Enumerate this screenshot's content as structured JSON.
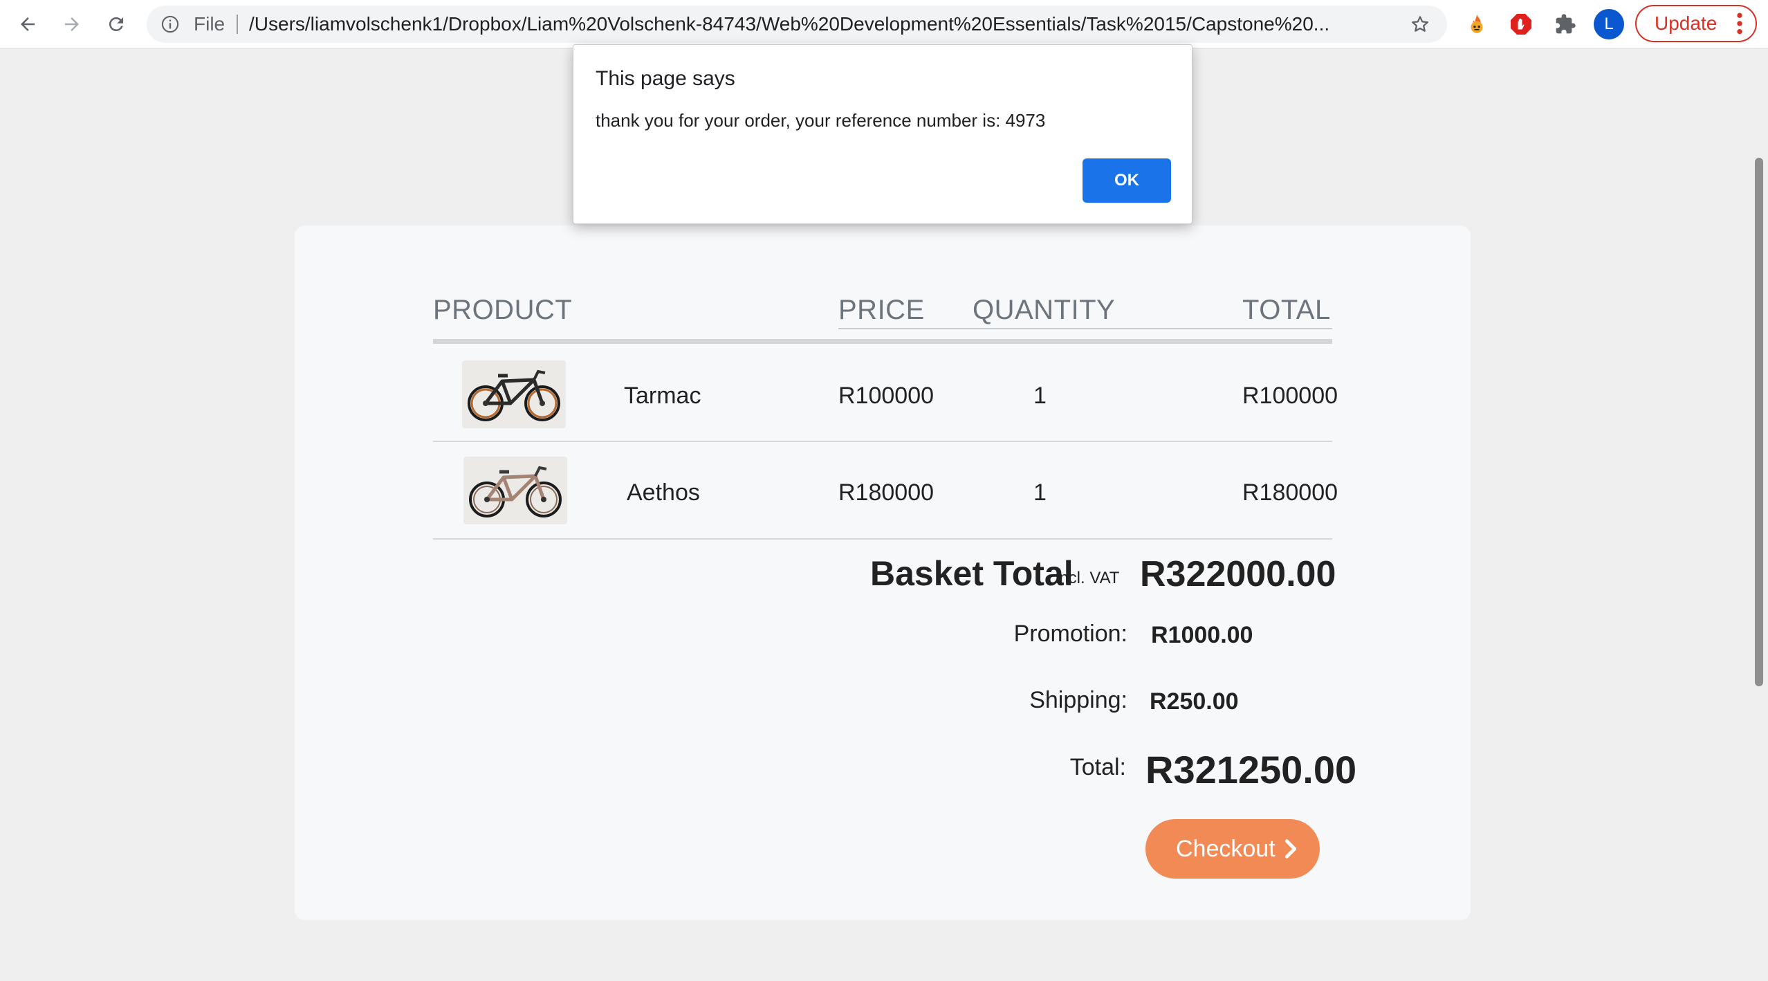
{
  "browser": {
    "omnibox": {
      "scheme_label": "File",
      "url": "/Users/liamvolschenk1/Dropbox/Liam%20Volschenk-84743/Web%20Development%20Essentials/Task%2015/Capstone%20..."
    },
    "profile_initial": "L",
    "update_label": "Update",
    "icons": {
      "back": "arrow-left",
      "forward": "arrow-right",
      "reload": "reload",
      "info": "info-circle",
      "bookmark": "star-outline",
      "extensions": [
        "flame-extension",
        "ad-block-stop",
        "puzzle-extensions"
      ],
      "menu": "kebab-menu"
    },
    "colors": {
      "update_accent": "#d93025",
      "profile": "#0b57d0"
    }
  },
  "dialog": {
    "title": "This page says",
    "message": "thank you for your order, your reference number is: 4973",
    "ok_label": "OK",
    "ok_color": "#1a73e8"
  },
  "cart": {
    "headers": {
      "product": "PRODUCT",
      "price": "PRICE",
      "quantity": "QUANTITY",
      "total": "TOTAL"
    },
    "items": [
      {
        "name": "Tarmac",
        "price": "R100000",
        "quantity": "1",
        "total": "R100000",
        "frame_color": "#2b2b2b"
      },
      {
        "name": "Aethos",
        "price": "R180000",
        "quantity": "1",
        "total": "R180000",
        "frame_color": "#a38373"
      }
    ],
    "basket_total_label": "Basket Total",
    "basket_total_sub": "incl. VAT",
    "basket_total_value": "R322000.00",
    "promotion_label": "Promotion:",
    "promotion_value": "R1000.00",
    "shipping_label": "Shipping:",
    "shipping_value": "R250.00",
    "total_label": "Total:",
    "total_value": "R321250.00",
    "checkout_label": "Checkout",
    "checkout_color": "#f28a56"
  }
}
